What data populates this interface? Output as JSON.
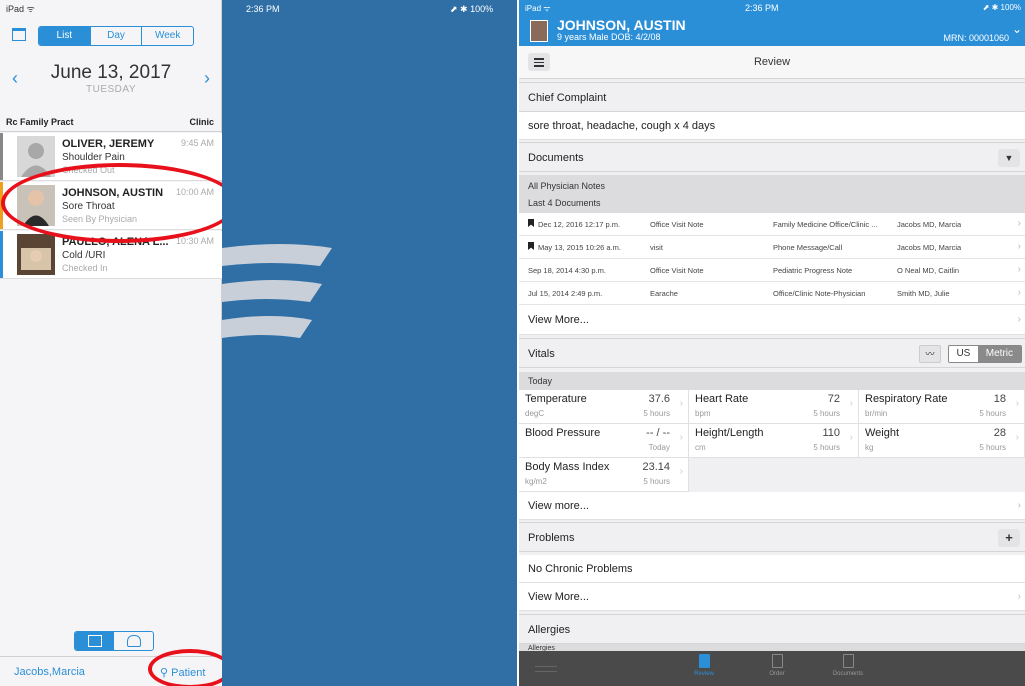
{
  "left_screen": {
    "status": {
      "carrier": "iPad ᯤ",
      "time": "2:36 PM",
      "battery": "⬈ ✱ 100%"
    },
    "view_toggle": [
      "List",
      "Day",
      "Week"
    ],
    "date": {
      "main": "June 13, 2017",
      "weekday": "TUESDAY"
    },
    "list_header": {
      "left": "Rc Family Pract",
      "right": "Clinic"
    },
    "appointments": [
      {
        "name": "OLIVER, JEREMY",
        "time": "9:45 AM",
        "reason": "Shoulder Pain",
        "status": "Checked Out",
        "bar_color": "#888888"
      },
      {
        "name": "JOHNSON, AUSTIN",
        "time": "10:00 AM",
        "reason": "Sore Throat",
        "status": "Seen By Physician",
        "bar_color": "#f0a020"
      },
      {
        "name": "PAULLO, ALENA L...",
        "time": "10:30 AM",
        "reason": "Cold /URI",
        "status": "Checked In",
        "bar_color": "#2b8fd8"
      }
    ],
    "provider": "Jacobs,Marcia",
    "patient_search": "Patient"
  },
  "right_screen": {
    "status": {
      "carrier": "iPad ᯤ",
      "time": "2:36 PM",
      "battery": "⬈ ✱ 100%"
    },
    "patient": {
      "name": "JOHNSON, AUSTIN",
      "info": "9 years  Male  DOB: 4/2/08",
      "mrn": "MRN: 00001060"
    },
    "review_title": "Review",
    "chief_complaint": {
      "heading": "Chief Complaint",
      "text": "sore throat, headache, cough x 4 days"
    },
    "documents": {
      "heading": "Documents",
      "filter_label": "All Physician Notes",
      "count_label": "Last 4 Documents",
      "rows": [
        {
          "date": "Dec 12, 2016 12:17 p.m.",
          "type": "Office Visit Note",
          "category": "Family Medicine Office/Clinic ...",
          "author": "Jacobs MD, Marcia"
        },
        {
          "date": "May 13, 2015 10:26 a.m.",
          "type": "visit",
          "category": "Phone Message/Call",
          "author": "Jacobs MD, Marcia"
        },
        {
          "date": "Sep 18, 2014 4:30 p.m.",
          "type": "Office Visit Note",
          "category": "Pediatric Progress Note",
          "author": "O Neal MD, Caitlin"
        },
        {
          "date": "Jul 15, 2014 2:49 p.m.",
          "type": "Earache",
          "category": "Office/Clinic Note-Physician",
          "author": "Smith MD, Julie"
        }
      ],
      "view_more": "View More..."
    },
    "vitals": {
      "heading": "Vitals",
      "units": [
        "US",
        "Metric"
      ],
      "period": "Today",
      "items": [
        {
          "name": "Temperature",
          "unit": "degC",
          "value": "37.6",
          "time": "5 hours"
        },
        {
          "name": "Heart Rate",
          "unit": "bpm",
          "value": "72",
          "time": "5 hours"
        },
        {
          "name": "Respiratory Rate",
          "unit": "br/min",
          "value": "18",
          "time": "5 hours"
        },
        {
          "name": "Blood Pressure",
          "unit": "",
          "value": "-- / --",
          "time": "Today"
        },
        {
          "name": "Height/Length",
          "unit": "cm",
          "value": "110",
          "time": "5 hours"
        },
        {
          "name": "Weight",
          "unit": "kg",
          "value": "28",
          "time": "5 hours"
        },
        {
          "name": "Body Mass Index",
          "unit": "kg/m2",
          "value": "23.14",
          "time": "5 hours"
        }
      ],
      "view_more": "View more..."
    },
    "problems": {
      "heading": "Problems",
      "text": "No Chronic Problems",
      "view_more": "View More..."
    },
    "allergies": {
      "heading": "Allergies",
      "sub": "Allergies"
    },
    "tabs": [
      "Review",
      "Order",
      "Documents"
    ]
  },
  "colors": {
    "accent": "#2b8fd8",
    "annotation": "#e8101a",
    "splash_bg": "#2f6fa6"
  }
}
